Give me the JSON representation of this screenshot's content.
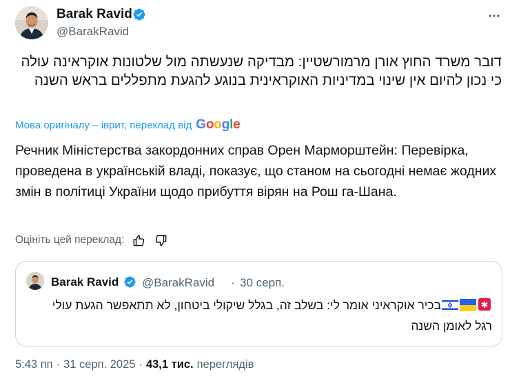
{
  "post": {
    "author_name": "Barak Ravid",
    "author_handle": "@BarakRavid",
    "original_text": "דובר משרד החוץ אורן מרמורשטיין: מבדיקה שנעשתה מול שלטונות אוקראינה עולה כי נכון להיום אין שינוי במדיניות האוקראינית בנוגע להגעת מתפללים בראש השנה",
    "translation_note": "Мова оригіналу – іврит, переклад від",
    "translation_provider": "Google",
    "translated_text": "Речник Міністерства закордонних справ Орен Марморштейн: Перевірка, проведена в українській владі, показує, що станом на сьогодні немає жодних змін в політиці України щодо прибуття вірян на Рош га-Шана.",
    "rate_label": "Оцініть цей переклад:"
  },
  "quote": {
    "author_name": "Barak Ravid",
    "author_handle": "@BarakRavid",
    "separator": "·",
    "date": "30 серп.",
    "text_part1": "בכיר אוקראיני אומר לי: בשלב זה, בגלל שיקולי ביטחון, לא תתאפשר הגעת עולי רגל לאומן השנה"
  },
  "footer": {
    "time": "5:43 пп",
    "separator": "·",
    "date": "31 серп. 2025",
    "views_count": "43,1 тис.",
    "views_label": "переглядів"
  },
  "icons": {
    "verified": "verified-badge-icon",
    "more": "more-options-icon",
    "thumbs_up": "thumbs-up-icon",
    "thumbs_down": "thumbs-down-icon",
    "siren": "siren-emoji",
    "flag_ukraine": "ukraine-flag-emoji",
    "flag_israel": "israel-flag-emoji"
  },
  "colors": {
    "accent": "#1d9bf0",
    "text_primary": "#0f1419",
    "text_secondary": "#536471",
    "border": "#cfd9de"
  }
}
